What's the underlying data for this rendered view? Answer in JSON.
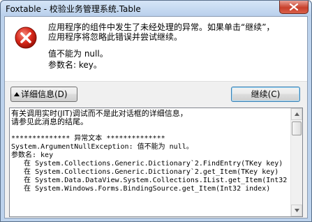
{
  "window": {
    "title": "Foxtable - 校验业务管理系统.Table"
  },
  "message": {
    "line1": "应用程序的组件中发生了未经处理的异常。如果单击“继续”，",
    "line2": "应用程序将忽略此错误并尝试继续。",
    "line3": "值不能为 null。",
    "line4": "参数名: key。"
  },
  "buttons": {
    "details_label": "详细信息(D)",
    "continue_label": "继续(C)"
  },
  "details": {
    "lines": [
      "有关调用实时(JIT)调试而不是此对话框的详细信息，",
      "请参见此消息的结尾。",
      "",
      "************** 异常文本 **************",
      "System.ArgumentNullException: 值不能为 null。",
      "参数名: key",
      "   在 System.Collections.Generic.Dictionary`2.FindEntry(TKey key)",
      "   在 System.Collections.Generic.Dictionary`2.get_Item(TKey key)",
      "   在 System.Data.DataView.System.Collections.IList.get_Item(Int32",
      "   在 System.Windows.Forms.BindingSource.get_Item(Int32 index)"
    ]
  }
}
